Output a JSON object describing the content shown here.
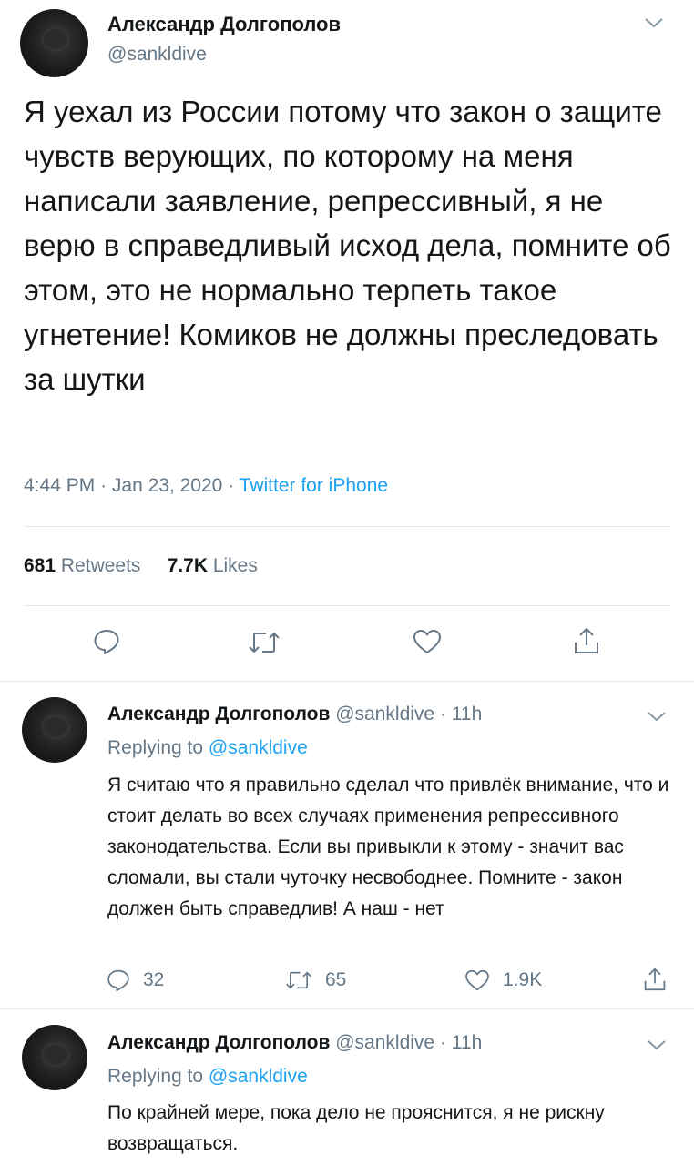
{
  "main_tweet": {
    "name": "Александр Долгополов",
    "handle": "@sankldive",
    "text": "Я уехал из России потому что закон о защите чувств верующих, по которому на меня написали заявление, репрессивный, я не верю в справедливый исход дела, помните об этом, это не нормально терпеть такое угнетение! Комиков не должны преследовать за шутки",
    "time": "4:44 PM",
    "date": "Jan 23, 2020",
    "separator": "·",
    "source": "Twitter for iPhone",
    "retweets_count": "681",
    "retweets_label": "Retweets",
    "likes_count": "7.7K",
    "likes_label": "Likes"
  },
  "replies": [
    {
      "name": "Александр Долгополов",
      "handle": "@sankldive",
      "age": "11h",
      "replying_prefix": "Replying to",
      "replying_to": "@sankldive",
      "text": "Я считаю что я правильно сделал что привлёк внимание, что и стоит делать во всех случаях применения репрессивного законодательства. Если вы привыкли к этому - значит вас сломали, вы стали чуточку несвободнее. Помните - закон должен быть справедлив! А наш - нет",
      "reply_count": "32",
      "retweet_count": "65",
      "like_count": "1.9K"
    },
    {
      "name": "Александр Долгополов",
      "handle": "@sankldive",
      "age": "11h",
      "replying_prefix": "Replying to",
      "replying_to": "@sankldive",
      "text": "По крайней мере, пока дело не прояснится, я не рискну возвращаться."
    }
  ],
  "icons": {
    "reply": "reply-icon",
    "retweet": "retweet-icon",
    "like": "heart-icon",
    "share": "share-icon",
    "menu": "chevron-down-icon"
  },
  "colors": {
    "text": "#14171a",
    "secondary": "#657786",
    "link": "#1da1f2",
    "divider": "#e1e8ed"
  }
}
